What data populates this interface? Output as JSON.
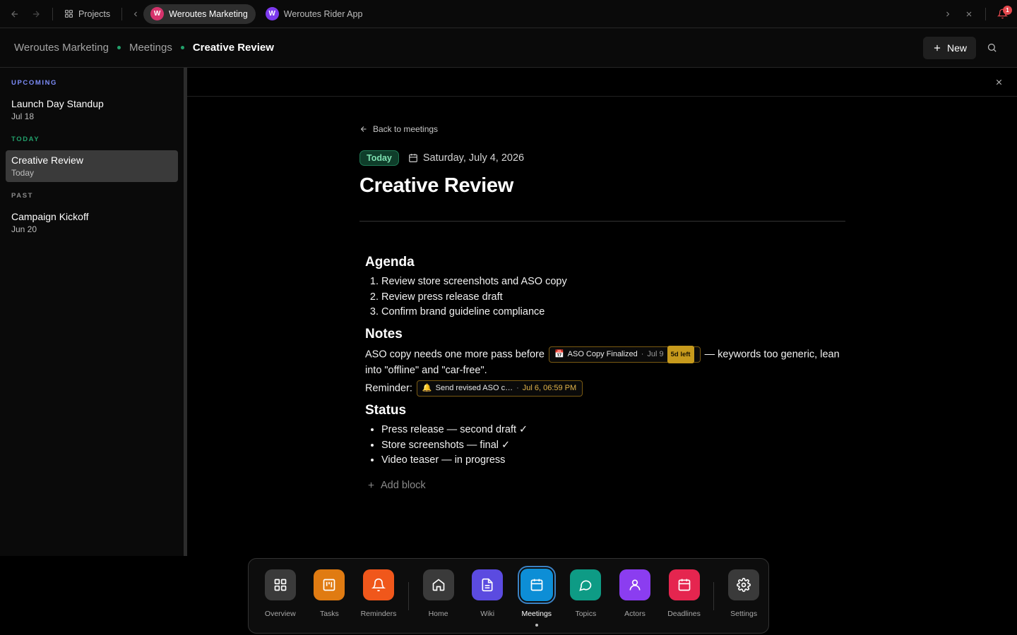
{
  "topbar": {
    "projects_label": "Projects",
    "notification_count": "1",
    "tabs": [
      {
        "label": "Weroutes Marketing",
        "avatar": "W",
        "color": "#d6336c",
        "active": true
      },
      {
        "label": "Weroutes Rider App",
        "avatar": "W",
        "color": "#7c3aed",
        "active": false
      }
    ]
  },
  "header": {
    "breadcrumb": [
      "Weroutes Marketing",
      "Meetings",
      "Creative Review"
    ],
    "new_label": "New"
  },
  "sidebar": {
    "sections": [
      {
        "label": "UPCOMING",
        "color": "#7c8cf8",
        "items": [
          {
            "title": "Launch Day Standup",
            "date": "Jul 18"
          }
        ]
      },
      {
        "label": "TODAY",
        "color": "#22a06b",
        "items": [
          {
            "title": "Creative Review",
            "date": "Today"
          }
        ]
      },
      {
        "label": "PAST",
        "color": "#8a8a8a",
        "items": [
          {
            "title": "Campaign Kickoff",
            "date": "Jun 20"
          }
        ]
      }
    ]
  },
  "meeting": {
    "back_label": "Back to meetings",
    "badge": "Today",
    "date": "Saturday, July 4, 2026",
    "title": "Creative Review",
    "agenda_heading": "Agenda",
    "agenda": [
      "Review store screenshots and ASO copy",
      "Review press release draft",
      "Confirm brand guideline compliance"
    ],
    "notes_heading": "Notes",
    "notes_before": "ASO copy needs one more pass before",
    "deadline_chip": {
      "icon": "📅",
      "title": "ASO Copy Finalized",
      "sep": "·",
      "date": "Jul 9",
      "left": "5d left"
    },
    "notes_after": "— keywords too generic, lean into \"offline\" and \"car-free\".",
    "reminder_label": "Reminder:",
    "reminder_chip": {
      "icon": "🔔",
      "title": "Send revised ASO c…",
      "sep": "·",
      "date": "Jul 6, 06:59 PM"
    },
    "status_heading": "Status",
    "status": [
      "Press release — second draft ✓",
      "Store screenshots — final ✓",
      "Video teaser — in progress"
    ],
    "add_block_label": "Add block"
  },
  "dock": {
    "items": [
      {
        "label": "Overview",
        "icon": "grid-icon",
        "color": "#3a3a3a"
      },
      {
        "label": "Tasks",
        "icon": "kanban-icon",
        "color": "#e07b12"
      },
      {
        "label": "Reminders",
        "icon": "bell-icon",
        "color": "#f0571b"
      },
      {
        "label": "Home",
        "icon": "home-icon",
        "color": "#3a3a3a"
      },
      {
        "label": "Wiki",
        "icon": "document-icon",
        "color": "#5b4be0"
      },
      {
        "label": "Meetings",
        "icon": "calendar-icon",
        "color": "#0d8ed6",
        "active": true
      },
      {
        "label": "Topics",
        "icon": "chat-icon",
        "color": "#0e9b85"
      },
      {
        "label": "Actors",
        "icon": "user-icon",
        "color": "#8b3df0"
      },
      {
        "label": "Deadlines",
        "icon": "calendar-alert-icon",
        "color": "#e5254f"
      },
      {
        "label": "Settings",
        "icon": "gear-icon",
        "color": "#3a3a3a"
      }
    ]
  }
}
